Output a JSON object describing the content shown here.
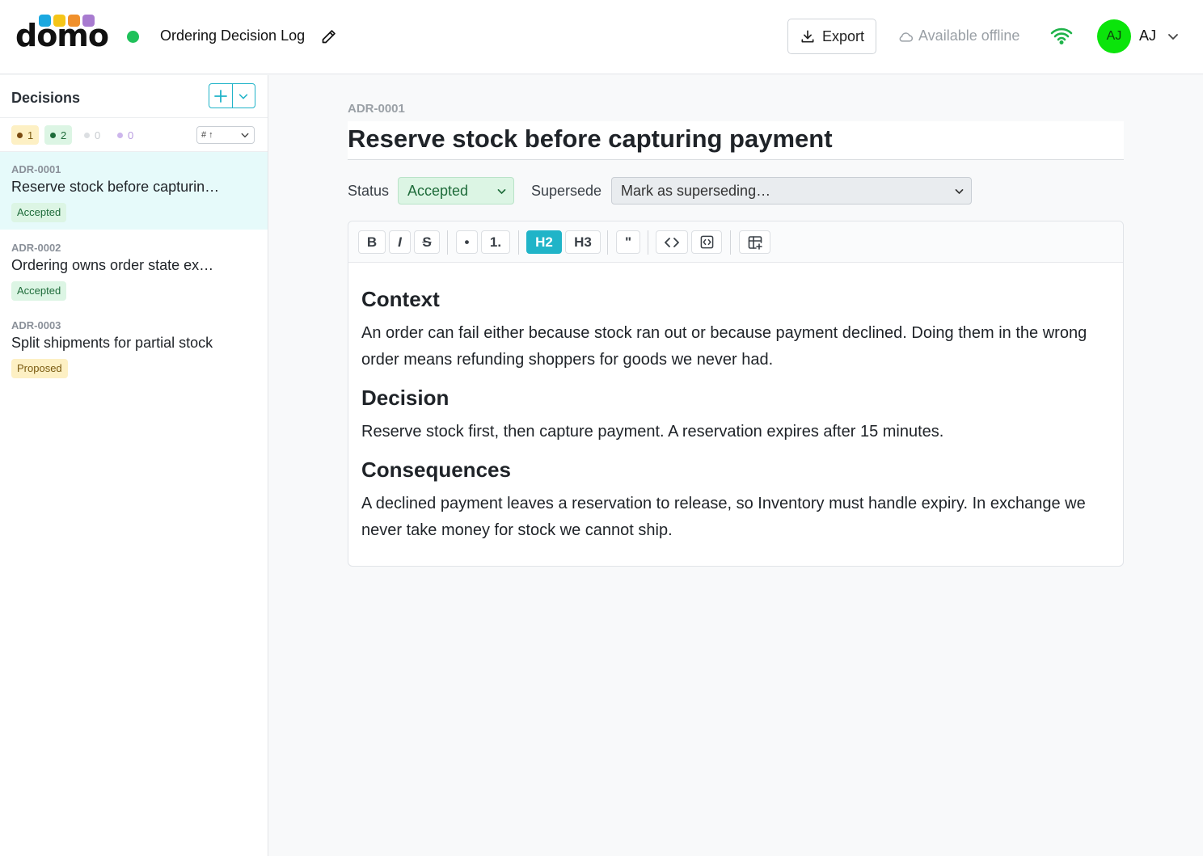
{
  "app": {
    "logo_text": "domo",
    "logo_dot_colors": [
      "#1ba8e0",
      "#f5c518",
      "#f0902c",
      "#a87bd0"
    ],
    "doc_title": "Ordering Decision Log",
    "sync_color": "#1fc15a"
  },
  "header": {
    "export_label": "Export",
    "offline_label": "Available offline",
    "user_initials": "AJ",
    "user_name": "AJ"
  },
  "sidebar": {
    "title": "Decisions",
    "filters": [
      {
        "count": "1",
        "color": "#7a4a10",
        "bg": "#fdf0c4"
      },
      {
        "count": "2",
        "color": "#1e6b3a",
        "bg": "#dcf5e4"
      },
      {
        "count": "0",
        "color": "#c8ccd0",
        "bg": "#ffffff"
      },
      {
        "count": "0",
        "color": "#b99ce0",
        "bg": "#ffffff"
      }
    ],
    "sort_label": "# ↑",
    "items": [
      {
        "id": "ADR-0001",
        "title": "Reserve stock before capturin…",
        "status": "Accepted"
      },
      {
        "id": "ADR-0002",
        "title": "Ordering owns order state ex…",
        "status": "Accepted"
      },
      {
        "id": "ADR-0003",
        "title": "Split shipments for partial stock",
        "status": "Proposed"
      }
    ]
  },
  "main": {
    "id": "ADR-0001",
    "title": "Reserve stock before capturing payment",
    "status_label": "Status",
    "status_value": "Accepted",
    "supersede_label": "Supersede",
    "supersede_placeholder": "Mark as superseding…"
  },
  "toolbar": {
    "bold": "B",
    "italic": "I",
    "strike": "S",
    "bullet": "•",
    "ordered": "1.",
    "h2": "H2",
    "h3": "H3",
    "quote": "\""
  },
  "content": {
    "h_context": "Context",
    "p_context": "An order can fail either because stock ran out or because payment declined. Doing them in the wrong order means refunding shoppers for goods we never had.",
    "h_decision": "Decision",
    "p_decision": "Reserve stock first, then capture payment. A reservation expires after 15 minutes.",
    "h_consequences": "Consequences",
    "p_consequences": "A declined payment leaves a reservation to release, so Inventory must handle expiry. In exchange we never take money for stock we cannot ship."
  }
}
